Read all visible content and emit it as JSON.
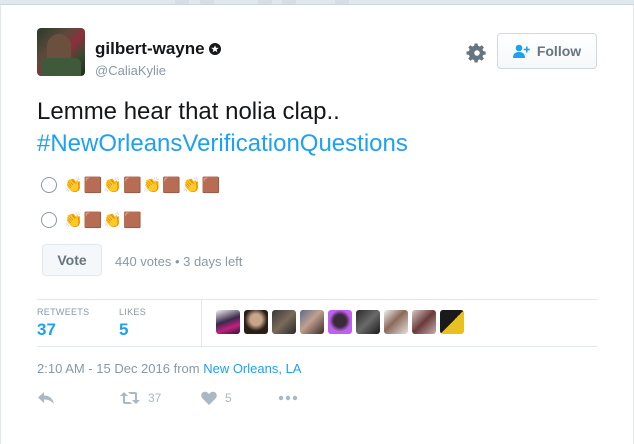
{
  "author": {
    "display_name": "gilbert-wayne",
    "handle": "@CaliaKylie"
  },
  "header": {
    "follow_label": "Follow"
  },
  "tweet": {
    "text": "Lemme hear that nolia clap..",
    "hashtag": "#NewOrleansVerificationQuestions"
  },
  "poll": {
    "options": [
      "👏🟫👏🟫👏🟫👏🟫",
      "👏🟫👏🟫"
    ],
    "vote_label": "Vote",
    "meta": "440 votes • 3 days left"
  },
  "stats": {
    "retweets_label": "RETWEETS",
    "retweets_value": "37",
    "likes_label": "LIKES",
    "likes_value": "5"
  },
  "timestamp": {
    "text": "2:10 AM - 15 Dec 2016 from ",
    "location": "New Orleans, LA"
  },
  "actions": {
    "retweet_count": "37",
    "like_count": "5"
  },
  "colors": {
    "link": "#1da1f2",
    "muted": "#8899a6"
  },
  "icons": [
    "badge-icon",
    "gear-icon",
    "add-user-icon",
    "reply-icon",
    "retweet-icon",
    "heart-icon",
    "more-icon"
  ]
}
